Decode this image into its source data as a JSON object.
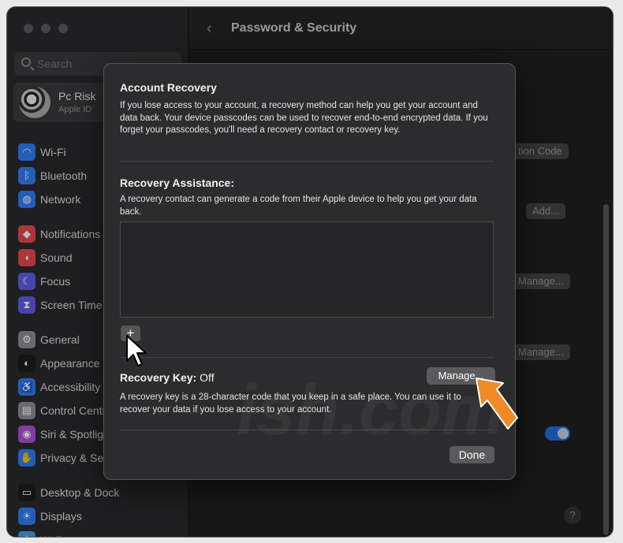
{
  "window": {
    "title": "Password & Security"
  },
  "search": {
    "placeholder": "Search"
  },
  "account": {
    "name": "Pc Risk",
    "subtitle": "Apple ID"
  },
  "sidebar": {
    "items": [
      {
        "label": "Wi-Fi",
        "icon": "wifi-icon",
        "color": "#2f7cf6",
        "glyph": "◠"
      },
      {
        "label": "Bluetooth",
        "icon": "bluetooth-icon",
        "color": "#2f7cf6",
        "glyph": "ᛒ"
      },
      {
        "label": "Network",
        "icon": "globe-icon",
        "color": "#2f7cf6",
        "glyph": "◍"
      },
      {
        "label": "Notifications",
        "icon": "bell-icon",
        "color": "#e5484d",
        "glyph": "◆"
      },
      {
        "label": "Sound",
        "icon": "speaker-icon",
        "color": "#e5484d",
        "glyph": "◖"
      },
      {
        "label": "Focus",
        "icon": "moon-icon",
        "color": "#5e5ce6",
        "glyph": "☾"
      },
      {
        "label": "Screen Time",
        "icon": "hourglass-icon",
        "color": "#5e5ce6",
        "glyph": "⧗"
      },
      {
        "label": "General",
        "icon": "gear-icon",
        "color": "#8e8e93",
        "glyph": "⚙"
      },
      {
        "label": "Appearance",
        "icon": "appearance-icon",
        "color": "#1c1c1e",
        "glyph": "◐"
      },
      {
        "label": "Accessibility",
        "icon": "accessibility-icon",
        "color": "#2f7cf6",
        "glyph": "♿"
      },
      {
        "label": "Control Centre",
        "icon": "control-centre-icon",
        "color": "#8e8e93",
        "glyph": "▤"
      },
      {
        "label": "Siri & Spotlight",
        "icon": "siri-icon",
        "color": "#b14fd8",
        "glyph": "◉"
      },
      {
        "label": "Privacy & Security",
        "icon": "hand-icon",
        "color": "#2f7cf6",
        "glyph": "✋"
      },
      {
        "label": "Desktop & Dock",
        "icon": "dock-icon",
        "color": "#1c1c1e",
        "glyph": "▭"
      },
      {
        "label": "Displays",
        "icon": "sun-icon",
        "color": "#2f7cf6",
        "glyph": "☀"
      },
      {
        "label": "Wallpaper",
        "icon": "wallpaper-icon",
        "color": "#3aa0e0",
        "glyph": "❀"
      }
    ]
  },
  "background": {
    "button1": "tion Code",
    "button2": "Add...",
    "button3": "Manage...",
    "button4": "Manage..."
  },
  "sheet": {
    "account_recovery": {
      "title": "Account Recovery",
      "text": "If you lose access to your account, a recovery method can help you get your account and data back. Your device passcodes can be used to recover end-to-end encrypted data. If you forget your passcodes, you'll need a recovery contact or recovery key."
    },
    "recovery_assistance": {
      "title": "Recovery Assistance:",
      "text": "A recovery contact can generate a code from their Apple device to help you get your data back.",
      "add_label": "+"
    },
    "recovery_key": {
      "label": "Recovery Key:",
      "status": "Off",
      "manage_label": "Manage...",
      "text": "A recovery key is a 28-character code that you keep in a safe place. You can use it to recover your data if you lose access to your account."
    },
    "done_label": "Done"
  },
  "watermark": "ish.com",
  "colors": {
    "accent": "#2f7cf6",
    "arrow": "#f08a24"
  }
}
